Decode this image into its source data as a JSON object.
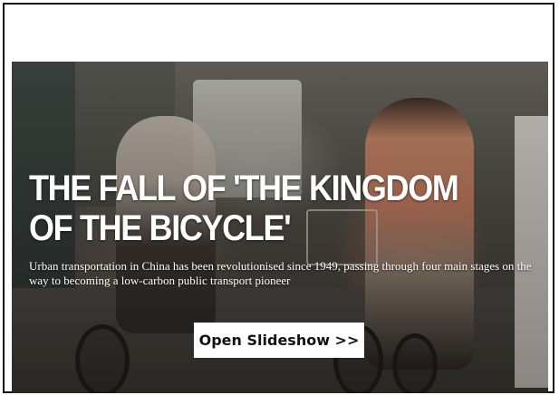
{
  "hero": {
    "title": "THE FALL OF 'THE KINGDOM OF THE BICYCLE'",
    "subtitle": "Urban transportation in China has been revolutionised since 1949, passing through four main stages on the way to becoming a low-carbon public transport pioneer",
    "button_label": "Open Slideshow >>",
    "image_subject": "cyclists-on-chinese-street-photo"
  },
  "colors": {
    "frame_border": "#111111",
    "button_background": "#ffffff",
    "button_text": "#111111",
    "title_text": "#ffffff"
  }
}
